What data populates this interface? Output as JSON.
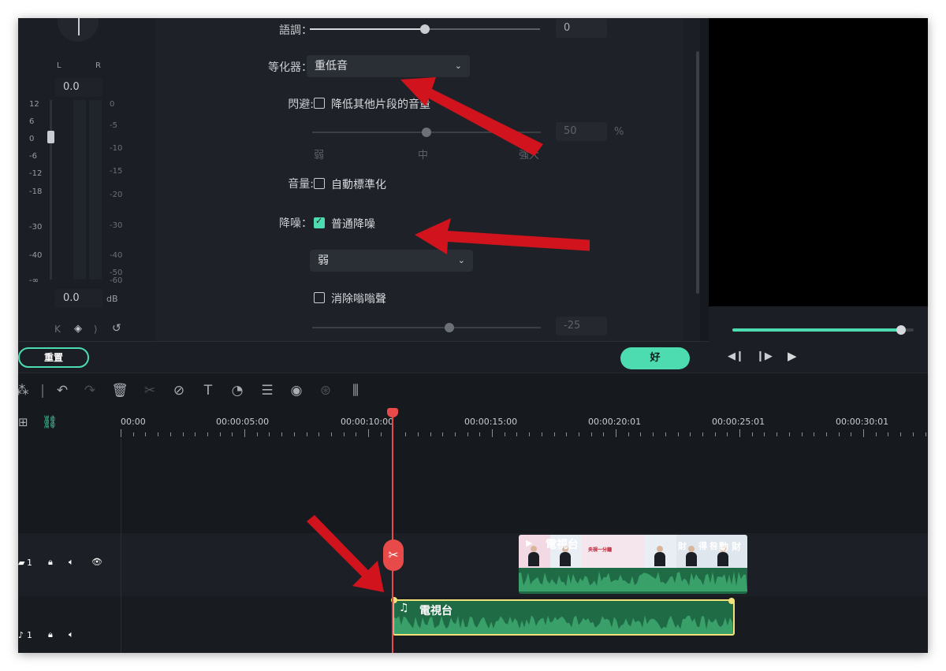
{
  "meter": {
    "l_label": "L",
    "r_label": "R",
    "pan_value": "0.0",
    "gain_value": "0.0",
    "db_unit": "dB",
    "scale_left": [
      "12",
      "6",
      "0",
      "-6",
      "-12",
      "-18",
      "-30",
      "-40",
      "-∞"
    ],
    "scale_right": [
      "0",
      "-5",
      "-10",
      "-15",
      "-20",
      "-30",
      "-40",
      "-50",
      "-60"
    ]
  },
  "settings": {
    "pitch_label": "語調：",
    "pitch_value": "0",
    "pitch_level": 0.5,
    "eq_label": "等化器：",
    "eq_selected": "重低音",
    "ducking_label": "閃避:",
    "ducking_option": "降低其他片段的音量",
    "ducking_checked": false,
    "ducking_value": "50",
    "ducking_unit": "%",
    "ducking_level": 0.5,
    "ducking_ticks": [
      "弱",
      "中",
      "強大"
    ],
    "volume_label": "音量:",
    "volume_option": "自動標準化",
    "volume_checked": false,
    "denoise_label": "降噪：",
    "denoise_option": "普通降噪",
    "denoise_checked": true,
    "denoise_level_selected": "弱",
    "hum_option": "消除嗡嗡聲",
    "hum_checked": false,
    "hum_value": "-25",
    "hum_level": 0.6
  },
  "buttons": {
    "reset": "重置",
    "ok": "好"
  },
  "preview": {
    "progress": 0.93
  },
  "ruler": {
    "labels": [
      "00:00",
      "00:00:05:00",
      "00:00:10:00",
      "00:00:15:00",
      "00:00:20:01",
      "00:00:25:01",
      "00:00:30:01"
    ]
  },
  "tracks": {
    "video_num": "1",
    "audio_num": "1"
  },
  "clips": {
    "video_title": "電視台",
    "audio_title": "電視台",
    "thumb_text": [
      "央視一分鐘",
      "財",
      "得",
      "咎",
      "動 財"
    ]
  },
  "colors": {
    "accent": "#4ddbb0",
    "playhead": "#e84a4a",
    "clip_green": "#1e6b45",
    "clip_selected_border": "#f3e27a",
    "annotation_arrow": "#d0131c"
  }
}
